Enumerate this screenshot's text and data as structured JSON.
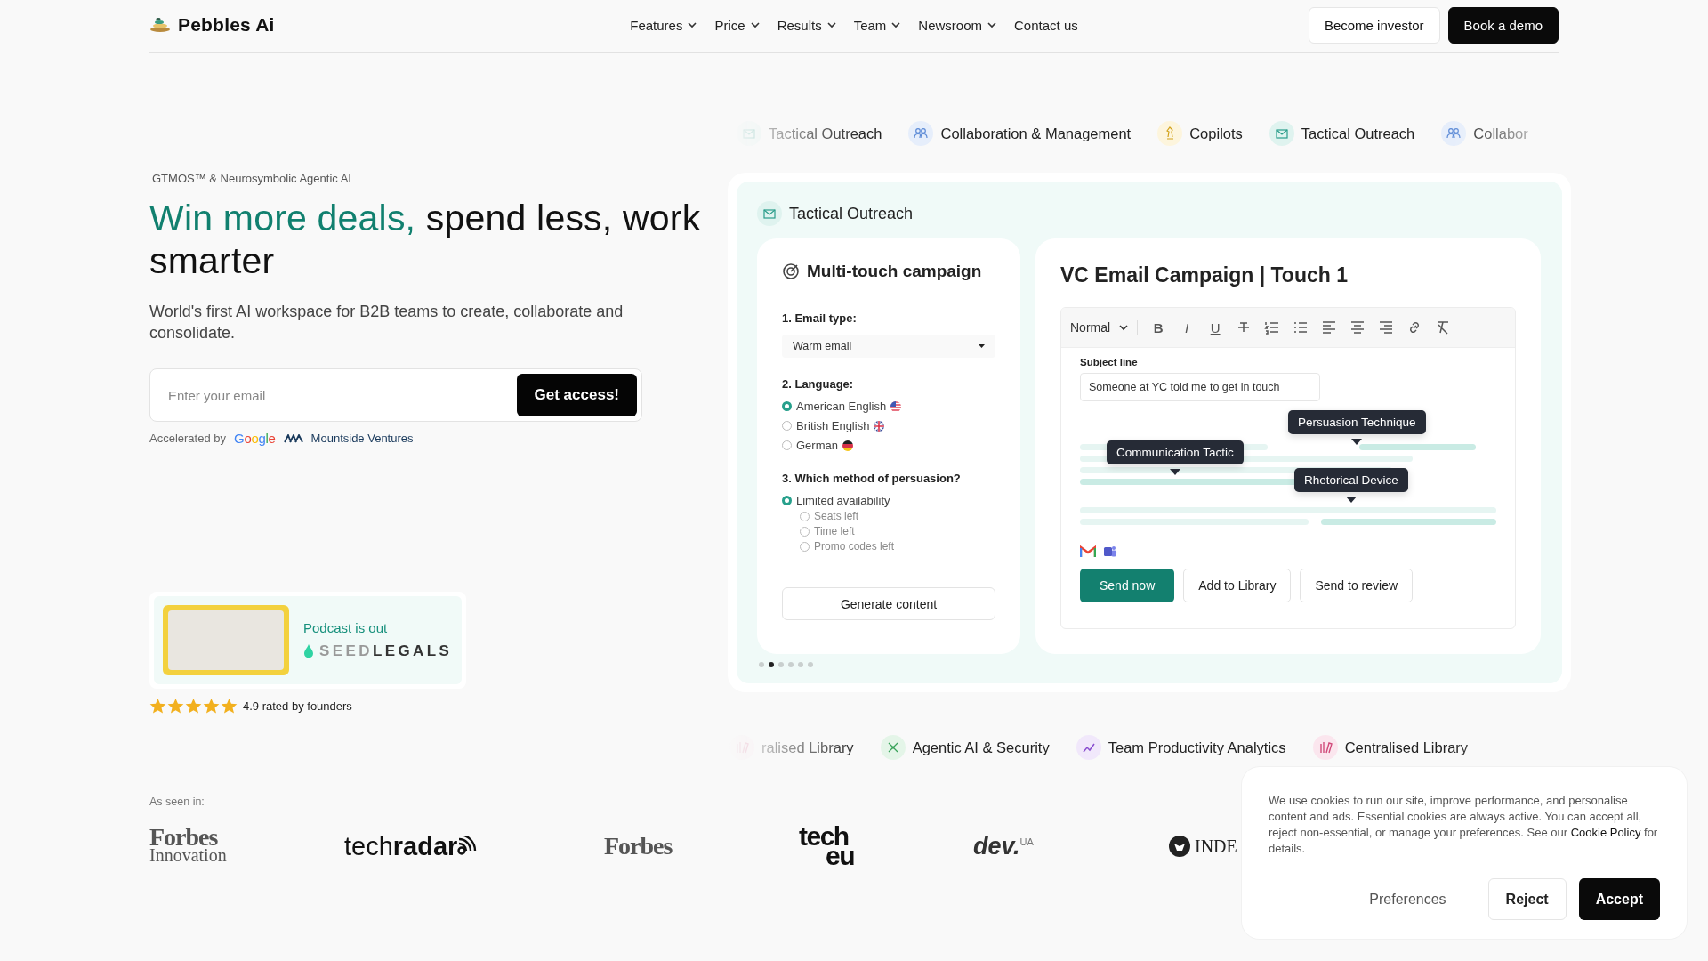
{
  "header": {
    "brand": "Pebbles Ai",
    "nav": [
      {
        "label": "Features",
        "dropdown": true
      },
      {
        "label": "Price",
        "dropdown": true
      },
      {
        "label": "Results",
        "dropdown": true
      },
      {
        "label": "Team",
        "dropdown": true
      },
      {
        "label": "Newsroom",
        "dropdown": true
      },
      {
        "label": "Contact us",
        "dropdown": false
      }
    ],
    "actions": [
      {
        "label": "Become investor",
        "kind": "outline"
      },
      {
        "label": "Book a demo",
        "kind": "solid"
      }
    ]
  },
  "hero": {
    "eyebrow": "GTMOS™ & Neurosymbolic Agentic AI",
    "headline_accent": "Win more deals,",
    "headline_rest": "spend less, work smarter",
    "subtitle": "World's first AI workspace for B2B teams to create, collaborate and consolidate.",
    "email": {
      "placeholder": "Enter your email"
    },
    "cta": "Get access!",
    "accelerated": {
      "label": "Accelerated by",
      "google": "Google",
      "partner": "Mountside Ventures"
    },
    "podcast": {
      "title": "Podcast is out",
      "logo_light": "SEED",
      "logo_dark": "LEGALS"
    },
    "rating": {
      "stars": 5,
      "text": "4.9 rated by founders"
    }
  },
  "feature_strip_top": [
    {
      "label": "Tactical Outreach",
      "kind": "outreach"
    },
    {
      "label": "Collaboration & Management",
      "kind": "collaboration"
    },
    {
      "label": "Copilots",
      "kind": "copilot"
    },
    {
      "label": "Tactical Outreach",
      "kind": "outreach"
    },
    {
      "label": "Collabor",
      "kind": "collaboration"
    }
  ],
  "demo": {
    "section": {
      "label": "Tactical Outreach",
      "kind": "outreach"
    },
    "campaign": {
      "title": "Multi-touch campaign",
      "questions": [
        {
          "kind": "select",
          "label": "1. Email type:",
          "value": "Warm email"
        },
        {
          "kind": "radio",
          "label": "2. Language:",
          "options": [
            {
              "label": "American English",
              "selected": true,
              "kind": "us"
            },
            {
              "label": "British English",
              "selected": false,
              "kind": "uk"
            },
            {
              "label": "German",
              "selected": false,
              "kind": "de"
            }
          ]
        },
        {
          "kind": "radio",
          "label": "3. Which method of persuasion?",
          "options": [
            {
              "label": "Limited availability",
              "selected": true,
              "children": [
                {
                  "label": "Seats left",
                  "selected": false
                },
                {
                  "label": "Time left",
                  "selected": false
                },
                {
                  "label": "Promo codes left",
                  "selected": false
                }
              ]
            }
          ]
        }
      ],
      "button": "Generate content"
    },
    "editor": {
      "title": "VC Email Campaign | Touch 1",
      "style_select": "Normal",
      "toolbar": [
        {
          "kind": "bold",
          "glyph": "B"
        },
        {
          "kind": "italic",
          "glyph": "I"
        },
        {
          "kind": "underline",
          "glyph": "U"
        },
        {
          "kind": "strike"
        },
        {
          "kind": "ordered-list"
        },
        {
          "kind": "bullet-list"
        },
        {
          "kind": "align-left"
        },
        {
          "kind": "align-center"
        },
        {
          "kind": "align-right"
        },
        {
          "kind": "link"
        },
        {
          "kind": "clear-format"
        }
      ],
      "subject_label": "Subject line",
      "subject": "Someone at YC told me to get in touch",
      "annotations": [
        "Persuasion Technique",
        "Communication Tactic",
        "Rhetorical Device"
      ],
      "buttons": [
        {
          "label": "Send now",
          "kind": "primary"
        },
        {
          "label": "Add to Library",
          "kind": "outline"
        },
        {
          "label": "Send to review",
          "kind": "outline"
        }
      ]
    },
    "slides": [
      {
        "selected": false
      },
      {
        "selected": true
      },
      {
        "selected": false
      },
      {
        "selected": false
      },
      {
        "selected": false
      },
      {
        "selected": false
      }
    ]
  },
  "feature_strip_bottom": [
    {
      "label": "ralised Library",
      "kind": "library"
    },
    {
      "label": "Agentic AI & Security",
      "kind": "security"
    },
    {
      "label": "Team Productivity Analytics",
      "kind": "analytics"
    },
    {
      "label": "Centralised Library",
      "kind": "library"
    }
  ],
  "press": {
    "label": "As seen in:",
    "logos": [
      {
        "kind": "forbes-innovation",
        "lines": [
          "Forbes",
          "Innovation"
        ]
      },
      {
        "kind": "techradar",
        "lines": [
          "tech",
          "radar"
        ]
      },
      {
        "kind": "forbes",
        "lines": [
          "Forbes"
        ]
      },
      {
        "kind": "tech-eu",
        "lines": [
          "tech",
          "eu"
        ]
      },
      {
        "kind": "dev-ua",
        "lines": [
          "dev.",
          "UA"
        ]
      },
      {
        "kind": "independent",
        "lines": [
          "INDE"
        ]
      }
    ]
  },
  "cookie": {
    "text_before": "We use cookies to run our site, improve performance, and personalise content and ads. Essential cookies are always active. You can accept all, reject non-essential, or manage your preferences. See our",
    "link": "Cookie Policy",
    "text_after": "for details.",
    "buttons": [
      {
        "label": "Preferences",
        "kind": "text"
      },
      {
        "label": "Reject",
        "kind": "outline"
      },
      {
        "label": "Accept",
        "kind": "solid"
      }
    ]
  }
}
